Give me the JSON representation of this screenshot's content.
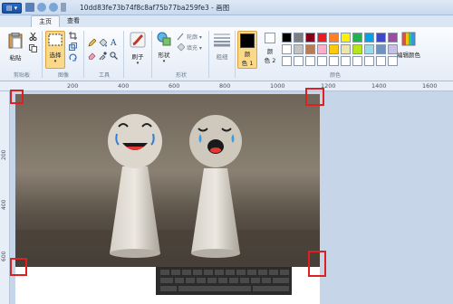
{
  "titlebar": {
    "app_button_label": "▤ ▾",
    "document_title": "10dd83fe73b74f8c8af75b77ba259fe3 - 画图"
  },
  "tabs": [
    {
      "label": "主页"
    },
    {
      "label": "查看"
    }
  ],
  "ribbon": {
    "clipboard": {
      "paste_label": "粘贴",
      "group_label": "剪贴板"
    },
    "image": {
      "select_label": "选择",
      "group_label": "图像"
    },
    "tools": {
      "group_label": "工具"
    },
    "brushes": {
      "label": "刷子"
    },
    "shapes": {
      "label": "形状",
      "outline_label": "轮廓 ▾",
      "fill_label": "填充 ▾",
      "group_label": "形状"
    },
    "size": {
      "label": "粗细"
    },
    "colors": {
      "color1_label_a": "颜",
      "color1_label_b": "色 1",
      "color2_label_a": "颜",
      "color2_label_b": "色 2",
      "edit_label": "编辑颜色",
      "group_label": "颜色",
      "color1_value": "#000000",
      "color2_value": "#ffffff"
    }
  },
  "palette": [
    "#000000",
    "#7f7f7f",
    "#880015",
    "#ed1c24",
    "#ff7f27",
    "#fff200",
    "#22b14c",
    "#00a2e8",
    "#3f48cc",
    "#a349a4",
    "#ffffff",
    "#c3c3c3",
    "#b97a57",
    "#ffaec9",
    "#ffc90e",
    "#efe4b0",
    "#b5e61d",
    "#99d9ea",
    "#7092be",
    "#c8bfe7",
    "#ffffff",
    "#ffffff",
    "#ffffff",
    "#ffffff",
    "#ffffff",
    "#ffffff",
    "#ffffff",
    "#ffffff",
    "#ffffff",
    "#ffffff"
  ],
  "ruler": {
    "top": [
      "200",
      "400",
      "600",
      "800",
      "1000",
      "1200",
      "1400",
      "1600"
    ],
    "left": [
      "200",
      "400",
      "600"
    ]
  }
}
